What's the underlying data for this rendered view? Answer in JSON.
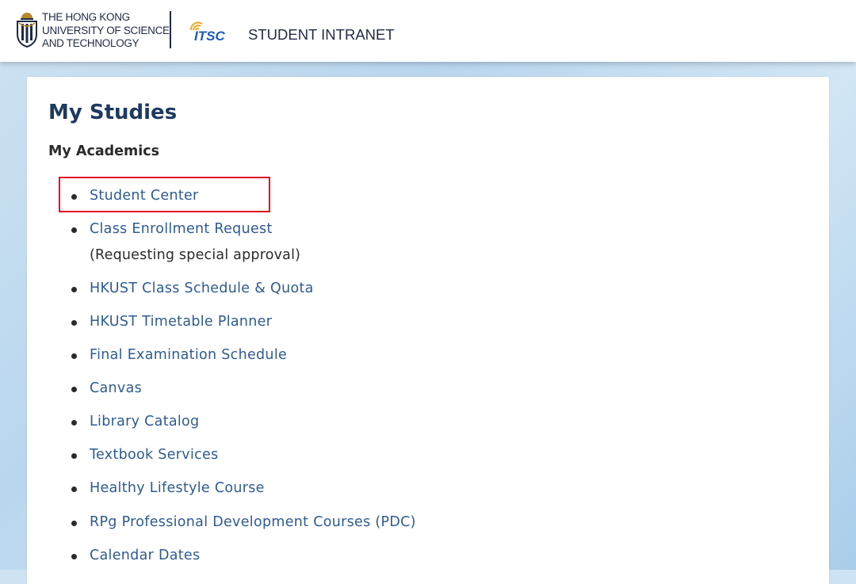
{
  "header": {
    "university_name_lines": [
      "THE HONG KONG",
      "UNIVERSITY OF SCIENCE",
      "AND TECHNOLOGY"
    ],
    "itsc_logo_text": "ITSC",
    "portal_title": "STUDENT INTRANET"
  },
  "main": {
    "page_title": "My Studies",
    "section_title": "My Academics",
    "links": [
      {
        "label": "Student Center",
        "highlighted": true
      },
      {
        "label": "Class Enrollment Request",
        "note": "(Requesting special approval)"
      },
      {
        "label": "HKUST Class Schedule & Quota"
      },
      {
        "label": "HKUST Timetable Planner"
      },
      {
        "label": "Final Examination Schedule"
      },
      {
        "label": "Canvas"
      },
      {
        "label": "Library Catalog"
      },
      {
        "label": "Textbook Services"
      },
      {
        "label": "Healthy Lifestyle Course"
      },
      {
        "label": "RPg Professional Development Courses (PDC)"
      },
      {
        "label": "Calendar Dates"
      }
    ]
  },
  "colors": {
    "link": "#2e5b92",
    "title": "#1d3a5f",
    "highlight_border": "#e0101e",
    "background": "#b8d6ee"
  },
  "icons": {
    "university_logo": "hkust-logo-icon",
    "itsc_logo": "itsc-logo-icon"
  }
}
